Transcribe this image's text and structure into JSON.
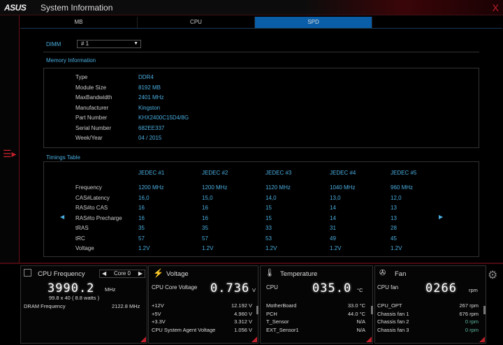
{
  "title": {
    "logo": "ASUS",
    "app": "System Information",
    "close": "X"
  },
  "tabs": [
    "MB",
    "CPU",
    "SPD"
  ],
  "dimm": {
    "label": "DIMM",
    "value": "# 1"
  },
  "memory": {
    "heading": "Memory Information",
    "rows": [
      {
        "k": "Type",
        "v": "DDR4"
      },
      {
        "k": "Module Size",
        "v": "8192 MB"
      },
      {
        "k": "MaxBandwidth",
        "v": "2401 MHz"
      },
      {
        "k": "Manufacturer",
        "v": "Kingston"
      },
      {
        "k": "Part Number",
        "v": "KHX2400C15D4/8G"
      },
      {
        "k": "Serial Number",
        "v": "682EE337"
      },
      {
        "k": "Week/Year",
        "v": "04 / 2015"
      }
    ]
  },
  "timings": {
    "heading": "Timings Table",
    "columns": [
      "JEDEC #1",
      "JEDEC #2",
      "JEDEC #3",
      "JEDEC #4",
      "JEDEC #5"
    ],
    "rows": [
      {
        "k": "Frequency",
        "v": [
          "1200 MHz",
          "1200 MHz",
          "1120 MHz",
          "1040 MHz",
          "960 MHz"
        ]
      },
      {
        "k": "CAS#Latency",
        "v": [
          "16,0",
          "15,0",
          "14,0",
          "13,0",
          "12,0"
        ]
      },
      {
        "k": "RAS#to CAS",
        "v": [
          "16",
          "16",
          "15",
          "14",
          "13"
        ]
      },
      {
        "k": "RAS#to Precharge",
        "v": [
          "16",
          "16",
          "15",
          "14",
          "13"
        ]
      },
      {
        "k": "tRAS",
        "v": [
          "35",
          "35",
          "33",
          "31",
          "28"
        ]
      },
      {
        "k": "tRC",
        "v": [
          "57",
          "57",
          "53",
          "49",
          "45"
        ]
      },
      {
        "k": "Voltage",
        "v": [
          "1.2V",
          "1.2V",
          "1.2V",
          "1.2V",
          "1.2V"
        ]
      }
    ]
  },
  "cpu": {
    "title": "CPU Frequency",
    "core": "Core 0",
    "freq": "3990.2",
    "unit": "MHz",
    "detail": "99.8  x 40  ( 8.8    watts )",
    "dram_label": "DRAM Frequency",
    "dram_value": "2122.8  MHz"
  },
  "voltage": {
    "title": "Voltage",
    "main_label": "CPU Core Voltage",
    "main_value": "0.736",
    "main_unit": "V",
    "rows": [
      {
        "k": "+12V",
        "v": "12.192  V"
      },
      {
        "k": "+5V",
        "v": "4.960  V"
      },
      {
        "k": "+3.3V",
        "v": "3.312  V"
      },
      {
        "k": "CPU System Agent Voltage",
        "v": "1.056  V"
      }
    ]
  },
  "temp": {
    "title": "Temperature",
    "main_label": "CPU",
    "main_value": "035.0",
    "main_unit": "°C",
    "rows": [
      {
        "k": "MotherBoard",
        "v": "33.0 °C"
      },
      {
        "k": "PCH",
        "v": "44.0 °C"
      },
      {
        "k": "T_Sensor",
        "v": "N/A"
      },
      {
        "k": "EXT_Sensor1",
        "v": "N/A"
      }
    ]
  },
  "fan": {
    "title": "Fan",
    "main_label": "CPU fan",
    "main_value": "0266",
    "main_unit": "rpm",
    "rows": [
      {
        "k": "CPU_OPT",
        "v": "267  rpm"
      },
      {
        "k": "Chassis fan 1",
        "v": "676  rpm"
      },
      {
        "k": "Chassis fan 2",
        "v": "0  rpm"
      },
      {
        "k": "Chassis fan 3",
        "v": "0  rpm"
      }
    ]
  },
  "colors": {
    "accent": "#0a5ea8",
    "label": "#4aaee0",
    "red": "#c0202a"
  }
}
